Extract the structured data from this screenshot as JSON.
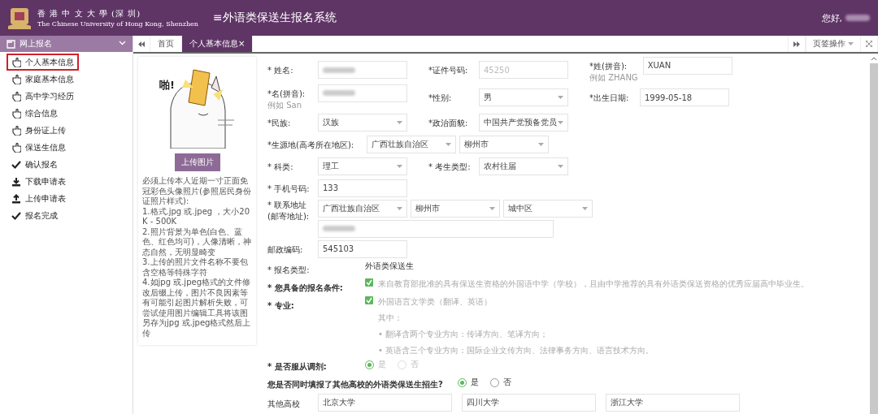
{
  "header": {
    "logo_cn": "香 港 中 文 大 學 (深 圳)",
    "logo_en": "The Chinese University of Hong Kong, Shenzhen",
    "title": "≡外语类保送生报名系统",
    "greeting": "您好,"
  },
  "sidebar": {
    "group": {
      "label": "网上报名",
      "expanded": true
    },
    "items": [
      {
        "label": "个人基本信息",
        "kind": "hand",
        "selected": true
      },
      {
        "label": "家庭基本信息",
        "kind": "hand",
        "selected": false
      },
      {
        "label": "高中学习经历",
        "kind": "hand",
        "selected": false
      },
      {
        "label": "综合信息",
        "kind": "hand",
        "selected": false
      },
      {
        "label": "身份证上传",
        "kind": "hand",
        "selected": false
      },
      {
        "label": "保送生信息",
        "kind": "hand",
        "selected": false
      },
      {
        "label": "确认报名",
        "kind": "check",
        "selected": false
      },
      {
        "label": "下载申请表",
        "kind": "download",
        "selected": false
      },
      {
        "label": "上传申请表",
        "kind": "upload",
        "selected": false
      },
      {
        "label": "报名完成",
        "kind": "check",
        "selected": false
      }
    ]
  },
  "tabs": {
    "items": [
      {
        "label": "首页",
        "selected": false,
        "closable": false
      },
      {
        "label": "个人基本信息",
        "selected": true,
        "closable": true
      }
    ],
    "close": "×",
    "menu": "页签操作"
  },
  "photo": {
    "kind": "picture",
    "exclaim": "啪!",
    "button": "上传图片",
    "notes": [
      "必须上传本人近期一寸正面免冠彩色头像照片(参照居民身份证照片样式):",
      "1.格式.jpg 或.jpeg ，大小20K - 500K",
      "2.照片背景为单色(白色、蓝色、红色均可)，人像清晰，神态自然，无明显畸变",
      "3.上传的照片文件名称不要包含空格等特殊字符",
      "4.如jpg 或.jpeg格式的文件修改后缀上传，图片不良因素等有可能引起图片解析失败，可尝试使用图片编辑工具将该图另存为jpg 或.jpeg格式然后上传"
    ]
  },
  "form": {
    "rows": [
      {
        "fields": [
          {
            "label": "* 姓名:",
            "kind": "input"
          },
          {
            "label": "*证件号码:",
            "kind": "input",
            "value": "45250",
            "disabled": true
          },
          {
            "label": "*姓(拼音):",
            "hint": "例如 ZHANG",
            "kind": "input",
            "value": "XUAN"
          }
        ]
      },
      {
        "fields": [
          {
            "label": "*名(拼音):",
            "hint": "例如 San",
            "kind": "input"
          },
          {
            "label": "*性别:",
            "kind": "select",
            "value": "男"
          },
          {
            "label": "*出生日期:",
            "kind": "input",
            "value": "1999-05-18"
          }
        ]
      },
      {
        "fields": [
          {
            "label": "*民族:",
            "kind": "select",
            "value": "汉族"
          },
          {
            "label": "*政治面貌:",
            "kind": "select",
            "value": "中国共产党预备党员"
          }
        ]
      },
      {
        "fields": [
          {
            "label": "*生源地(高考所在地区):",
            "kind": "multi",
            "values": [
              "广西壮族自治区",
              "柳州市"
            ]
          }
        ]
      },
      {
        "fields": [
          {
            "label": "* 科类:",
            "kind": "select",
            "value": "理工"
          },
          {
            "label": "* 考生类型:",
            "kind": "select",
            "value": "农村往届"
          }
        ]
      },
      {
        "fields": [
          {
            "label": "* 手机号码:",
            "kind": "input",
            "value": "133"
          }
        ]
      },
      {
        "fields": [
          {
            "label": "* 联系地址(邮寄地址):",
            "kind": "address",
            "values": [
              "广西壮族自治区",
              "柳州市",
              "城中区"
            ]
          }
        ]
      },
      {
        "fields": [
          {
            "label": "邮政编码:",
            "kind": "input",
            "value": "545103"
          }
        ]
      }
    ],
    "type": {
      "label": "* 报名类型:",
      "value": "外语类保送生"
    },
    "checks": [
      {
        "label": "* 您具备的报名条件:",
        "checked": true,
        "text": "来自教育部批准的具有保送生资格的外国语中学（学校），且由中学推荐的具有外语类保送资格的优秀应届高中毕业生。"
      },
      {
        "label": "* 专业:",
        "checked": true,
        "text": "外国语言文学类（翻译、英语）",
        "notes": [
          "其中：",
          "• 翻译含两个专业方向：传译方向、笔译方向；",
          "• 英语含三个专业方向：国际企业文传方向、法律事务方向、语言技术方向。"
        ]
      }
    ],
    "adjust": {
      "label": "* 是否服从调剂:",
      "disabled": true,
      "options": [
        {
          "label": "是",
          "selected": true
        },
        {
          "label": "否",
          "selected": false
        }
      ]
    },
    "other": {
      "label": "您是否同时填报了其他高校的外语类保送生招生?",
      "options": [
        {
          "label": "是",
          "selected": true
        },
        {
          "label": "否",
          "selected": false
        }
      ]
    },
    "schools": {
      "label": "其他高校",
      "values": [
        "北京大学",
        "四川大学",
        "浙江大学"
      ]
    }
  }
}
